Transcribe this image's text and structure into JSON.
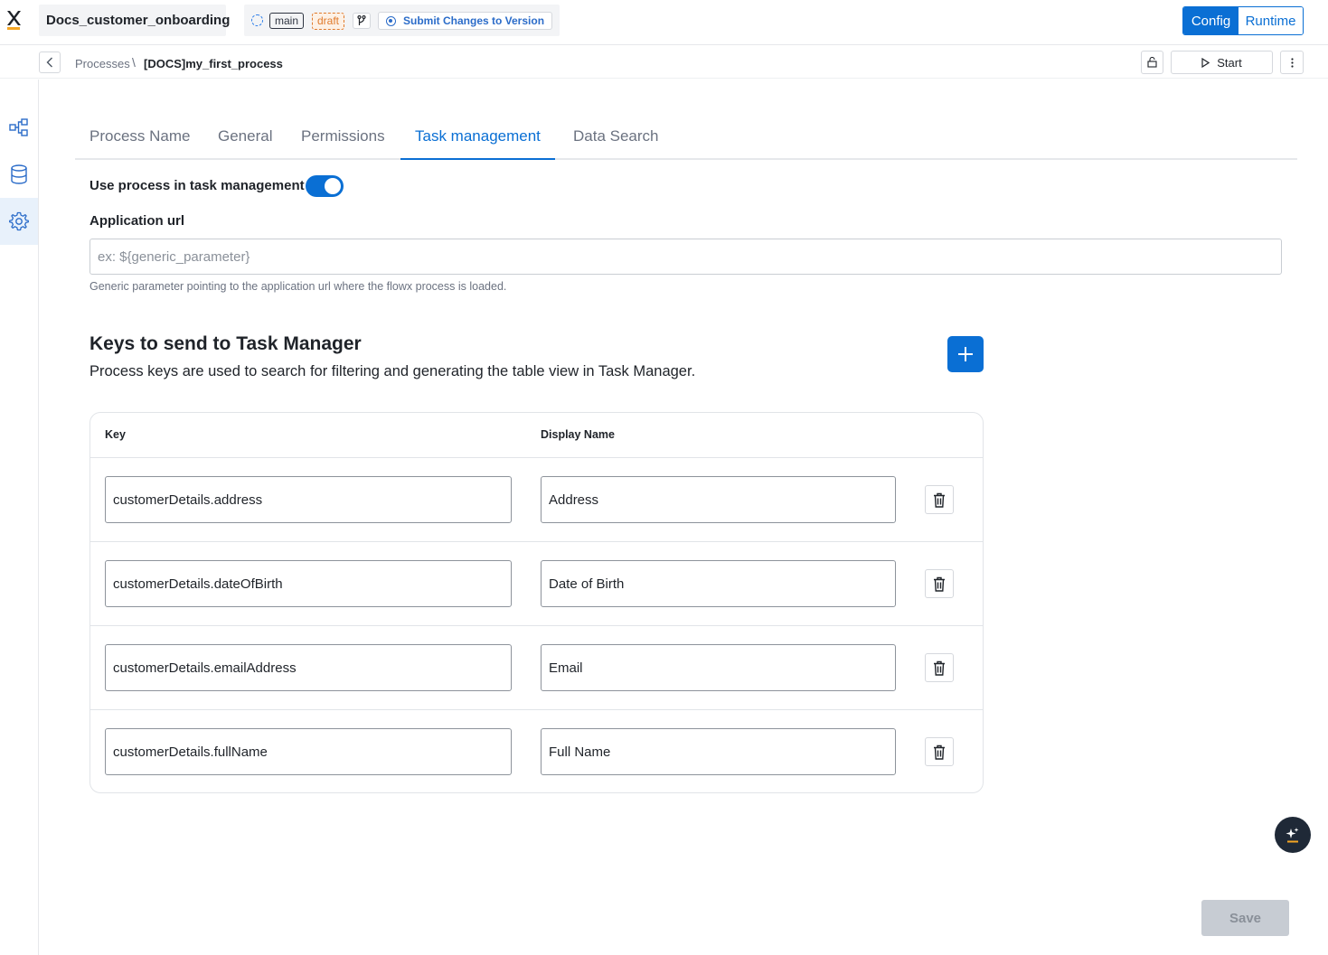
{
  "header": {
    "app_name": "Docs_customer_onboarding",
    "branch": "main",
    "status": "draft",
    "submit_label": "Submit Changes to Version",
    "modes": [
      "Config",
      "Runtime"
    ],
    "active_mode": "Config"
  },
  "breadcrumb": {
    "parent": "Processes",
    "separator": "\\",
    "current": "[DOCS]my_first_process"
  },
  "actions": {
    "start_label": "Start"
  },
  "sidebar": {
    "items": [
      {
        "icon": "process-flow-icon",
        "active": false
      },
      {
        "icon": "database-icon",
        "active": false
      },
      {
        "icon": "gear-icon",
        "active": true
      }
    ]
  },
  "tabs": [
    {
      "label": "Process Name",
      "active": false
    },
    {
      "label": "General",
      "active": false
    },
    {
      "label": "Permissions",
      "active": false
    },
    {
      "label": "Task management",
      "active": true
    },
    {
      "label": "Data Search",
      "active": false
    }
  ],
  "task_management": {
    "toggle_label": "Use process in task management",
    "toggle_on": true,
    "url_label": "Application url",
    "url_value": "",
    "url_placeholder": "ex: ${generic_parameter}",
    "url_help": "Generic parameter pointing to the application url where the flowx process is loaded.",
    "keys_title": "Keys to send to Task Manager",
    "keys_description": "Process keys are used to search for filtering and generating the table view in Task Manager.",
    "table_headers": {
      "key": "Key",
      "display_name": "Display Name"
    },
    "rows": [
      {
        "key": "customerDetails.address",
        "display_name": "Address"
      },
      {
        "key": "customerDetails.dateOfBirth",
        "display_name": "Date of Birth"
      },
      {
        "key": "customerDetails.emailAddress",
        "display_name": "Email"
      },
      {
        "key": "customerDetails.fullName",
        "display_name": "Full Name"
      }
    ]
  },
  "footer": {
    "save_label": "Save"
  },
  "colors": {
    "accent": "#0a6fd4",
    "draft": "#e07b2d",
    "disabled": "#c7ccd3"
  }
}
